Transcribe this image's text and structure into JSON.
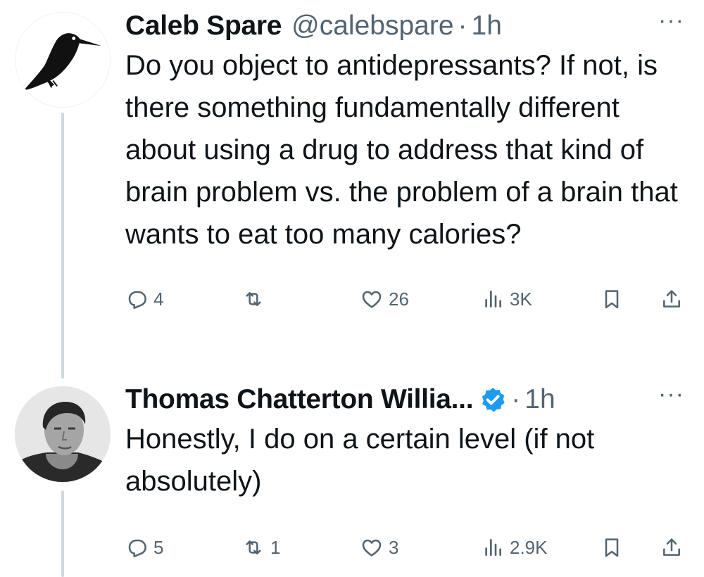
{
  "tweets": [
    {
      "author": {
        "name": "Caleb Spare",
        "handle": "@calebspare",
        "verified": false,
        "avatar_icon": "kingfisher-bird-icon"
      },
      "time": "1h",
      "separator": "·",
      "more": "···",
      "text": "Do you object to antidepressants? If not, is there something fundamentally different about using a drug to address that kind of brain problem vs. the problem of a brain that wants to eat too many calories?",
      "stats": {
        "replies": "4",
        "reposts": "",
        "likes": "26",
        "views": "3K"
      }
    },
    {
      "author": {
        "name": "Thomas Chatterton Willia...",
        "handle": "",
        "verified": true,
        "verified_color": "#1d9bf0",
        "avatar_icon": "portrait-photo"
      },
      "time": "1h",
      "separator": "·",
      "more": "···",
      "text": "Honestly, I do on a certain level (if not absolutely)",
      "stats": {
        "replies": "5",
        "reposts": "1",
        "likes": "3",
        "views": "2.9K"
      }
    }
  ],
  "colors": {
    "text": "#0f1419",
    "secondary": "#536471",
    "thread_line": "#cfd9de",
    "verified": "#1d9bf0"
  }
}
